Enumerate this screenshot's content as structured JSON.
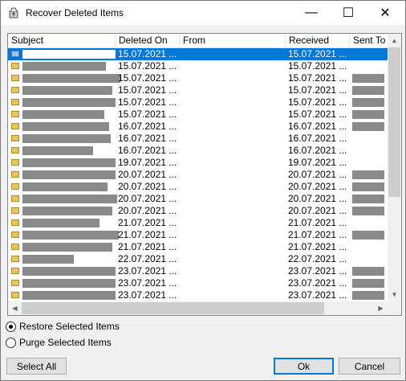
{
  "window": {
    "title": "Recover Deleted Items",
    "controls": {
      "minimize": "—",
      "maximize": "☐",
      "close": "✕"
    }
  },
  "list": {
    "columns": [
      "Subject",
      "Deleted On",
      "From",
      "Received",
      "Sent To"
    ],
    "rows": [
      {
        "deleted": "15.07.2021 ...",
        "received": "15.07.2021 ...",
        "selected": true
      },
      {
        "deleted": "15.07.2021 ...",
        "received": "15.07.2021 ..."
      },
      {
        "deleted": "15.07.2021 ...",
        "received": "15.07.2021 ..."
      },
      {
        "deleted": "15.07.2021 ...",
        "received": "15.07.2021 ..."
      },
      {
        "deleted": "15.07.2021 ...",
        "received": "15.07.2021 ..."
      },
      {
        "deleted": "15.07.2021 ...",
        "received": "15.07.2021 ..."
      },
      {
        "deleted": "16.07.2021 ...",
        "received": "16.07.2021 ..."
      },
      {
        "deleted": "16.07.2021 ...",
        "received": "16.07.2021 ..."
      },
      {
        "deleted": "16.07.2021 ...",
        "received": "16.07.2021 ..."
      },
      {
        "deleted": "19.07.2021 ...",
        "received": "19.07.2021 ..."
      },
      {
        "deleted": "20.07.2021 ...",
        "received": "20.07.2021 ..."
      },
      {
        "deleted": "20.07.2021 ...",
        "received": "20.07.2021 ..."
      },
      {
        "deleted": "20.07.2021 ...",
        "received": "20.07.2021 ..."
      },
      {
        "deleted": "20.07.2021 ...",
        "received": "20.07.2021 ..."
      },
      {
        "deleted": "21.07.2021 ...",
        "received": "21.07.2021 ..."
      },
      {
        "deleted": "21.07.2021 ...",
        "received": "21.07.2021 ..."
      },
      {
        "deleted": "21.07.2021 ...",
        "received": "21.07.2021 ..."
      },
      {
        "deleted": "22.07.2021 ...",
        "received": "22.07.2021 ..."
      },
      {
        "deleted": "23.07.2021 ...",
        "received": "23.07.2021 ..."
      },
      {
        "deleted": "23.07.2021 ...",
        "received": "23.07.2021 ..."
      },
      {
        "deleted": "23.07.2021 ...",
        "received": "23.07.2021 ..."
      }
    ]
  },
  "options": {
    "restore": "Restore Selected Items",
    "purge": "Purge Selected Items",
    "selected": "restore"
  },
  "buttons": {
    "select_all": "Select All",
    "ok": "Ok",
    "cancel": "Cancel"
  },
  "colors": {
    "selection": "#0078d7",
    "folder": "#e8c45a",
    "redaction": "#8a8a8a"
  },
  "icons": {
    "app": "recover-items-icon",
    "row": "folder-icon",
    "selected_row": "mail-item-icon"
  }
}
